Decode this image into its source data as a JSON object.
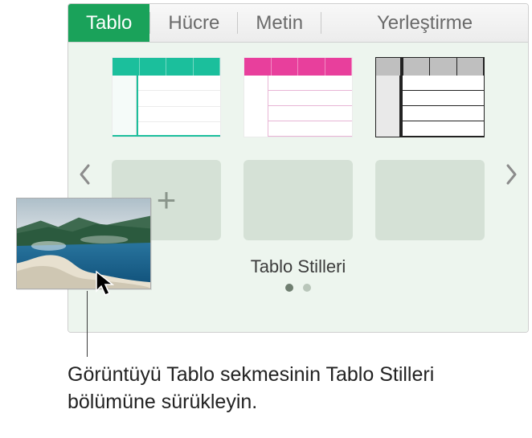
{
  "tabs": {
    "table": "Tablo",
    "cell": "Hücre",
    "text": "Metin",
    "arrange": "Yerleştirme"
  },
  "styles": {
    "section_title": "Tablo Stilleri",
    "add_label": "+",
    "thumbs": {
      "teal": "teal-table-style",
      "pink": "pink-table-style",
      "grey": "grey-table-style"
    }
  },
  "pager": {
    "page_count": 2,
    "active_page": 1
  },
  "callout": {
    "text": "Görüntüyü Tablo sekmesinin Tablo Stilleri bölümüne sürükleyin."
  },
  "nav": {
    "prev_icon": "chevron-left-icon",
    "next_icon": "chevron-right-icon"
  }
}
